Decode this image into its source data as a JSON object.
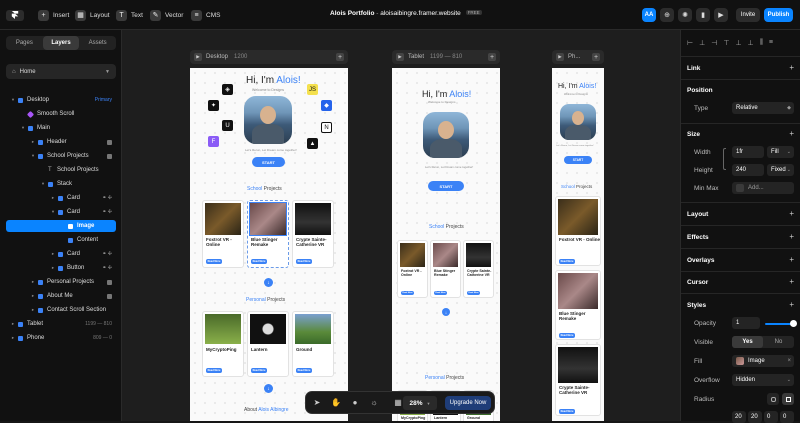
{
  "topbar": {
    "insert": "Insert",
    "layout": "Layout",
    "text": "Text",
    "vector": "Vector",
    "cms": "CMS",
    "project_name": "Alois Portfolio",
    "project_domain": "aloisaibingre.framer.website",
    "plan_badge": "FREE",
    "aa_label": "AA",
    "invite": "Invite",
    "publish": "Publish"
  },
  "left_panel": {
    "tabs": [
      "Pages",
      "Layers",
      "Assets"
    ],
    "active_tab": "Layers",
    "page_select": "Home",
    "layers": [
      {
        "label": "Desktop",
        "meta": "Primary"
      },
      {
        "label": "Smooth Scroll",
        "meta": ""
      },
      {
        "label": "Main",
        "meta": ""
      },
      {
        "label": "Header",
        "meta": ""
      },
      {
        "label": "School Projects",
        "meta": ""
      },
      {
        "label": "School Projects",
        "meta": ""
      },
      {
        "label": "Stack",
        "meta": ""
      },
      {
        "label": "Card",
        "meta": ""
      },
      {
        "label": "Card",
        "meta": ""
      },
      {
        "label": "Image",
        "meta": ""
      },
      {
        "label": "Content",
        "meta": ""
      },
      {
        "label": "Card",
        "meta": ""
      },
      {
        "label": "Button",
        "meta": ""
      },
      {
        "label": "Personal Projects",
        "meta": ""
      },
      {
        "label": "About Me",
        "meta": ""
      },
      {
        "label": "Contact Scroll Section",
        "meta": ""
      },
      {
        "label": "Tablet",
        "meta": "1199 — 810"
      },
      {
        "label": "Phone",
        "meta": "809 — 0"
      }
    ]
  },
  "canvas": {
    "frames": [
      {
        "name": "Desktop",
        "size": "1200"
      },
      {
        "name": "Tablet",
        "size": "1199 — 810"
      },
      {
        "name": "Ph...",
        "size": ""
      }
    ],
    "site": {
      "greeting": "Hi, I'm ",
      "name": "Alois!",
      "subtitle": "Welcome to Designs",
      "tagline": "Let's Rerun, Let Dream come together!",
      "start_button": "START",
      "school_word": "School",
      "projects_word": " Projects",
      "personal_word": "Personal",
      "about_word": "About ",
      "about_name": "Alois Albingre",
      "read_more": "Read More",
      "school_projects": [
        "Foxtrot VR - Online",
        "Blue Stinger Remake",
        "Crypte Sainte-Catherine VR"
      ],
      "personal_projects": [
        "MyCryptoPing",
        "Lantern",
        "Ground"
      ]
    },
    "zoom": "28%",
    "upgrade": "Upgrade Now"
  },
  "right_panel": {
    "link": "Link",
    "position": "Position",
    "type_label": "Type",
    "type_value": "Relative",
    "size": "Size",
    "width_label": "Width",
    "width_value": "1fr",
    "width_mode": "Fill",
    "height_label": "Height",
    "height_value": "240",
    "height_mode": "Fixed",
    "minmax_label": "Min Max",
    "minmax_value": "Add...",
    "layout": "Layout",
    "effects": "Effects",
    "overlays": "Overlays",
    "cursor": "Cursor",
    "styles": "Styles",
    "opacity_label": "Opacity",
    "opacity_value": "1",
    "visible_label": "Visible",
    "visible_yes": "Yes",
    "visible_no": "No",
    "fill_label": "Fill",
    "fill_value": "Image",
    "overflow_label": "Overflow",
    "overflow_value": "Hidden",
    "radius_label": "Radius",
    "radius_values": [
      "20",
      "20",
      "0",
      "0"
    ]
  },
  "colors": {
    "accent": "#0a84ff",
    "site_blue": "#3b82f6",
    "bg": "#161616"
  }
}
